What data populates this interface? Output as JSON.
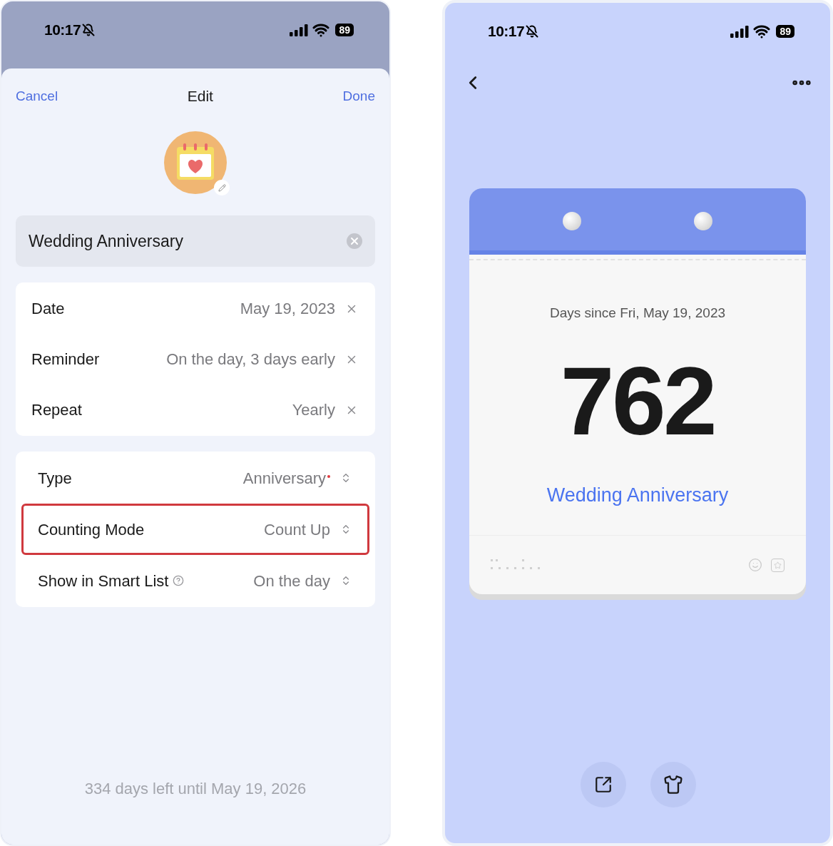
{
  "edit_screen": {
    "status_bar": {
      "time": "10:17",
      "battery": "89"
    },
    "nav": {
      "cancel": "Cancel",
      "title": "Edit",
      "done": "Done"
    },
    "name_field": {
      "value": "Wedding Anniversary"
    },
    "detail_rows": [
      {
        "label": "Date",
        "value": "May 19, 2023"
      },
      {
        "label": "Reminder",
        "value": "On the day, 3 days early"
      },
      {
        "label": "Repeat",
        "value": "Yearly"
      }
    ],
    "option_rows": [
      {
        "label": "Type",
        "value": "Anniversary",
        "new_dot": true,
        "info": false,
        "highlighted": false
      },
      {
        "label": "Counting Mode",
        "value": "Count Up",
        "new_dot": false,
        "info": false,
        "highlighted": true
      },
      {
        "label": "Show in Smart List",
        "value": "On the day",
        "new_dot": false,
        "info": true,
        "highlighted": false
      }
    ],
    "footer": "334 days left until May 19, 2026"
  },
  "detail_screen": {
    "status_bar": {
      "time": "10:17",
      "battery": "89"
    },
    "card": {
      "caption": "Days since Fri, May 19, 2023",
      "count": "762",
      "title": "Wedding Anniversary"
    }
  }
}
